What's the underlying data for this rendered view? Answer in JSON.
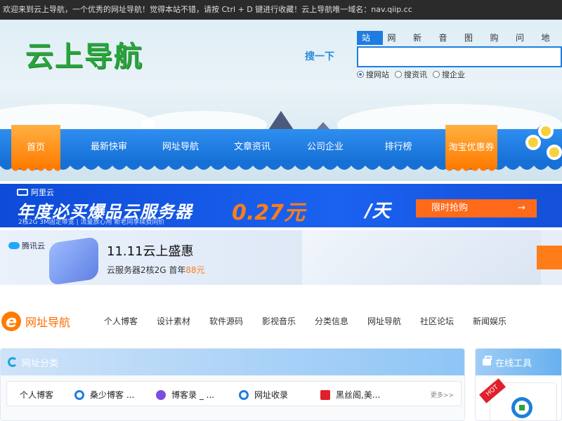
{
  "topbar": {
    "notice": "欢迎来到云上导航，一个优秀的网址导航！觉得本站不错，请按 Ctrl + D 键进行收藏！云上导航唯一域名：nav.qiip.cc"
  },
  "header": {
    "logo": "云上导航",
    "search_label": "搜一下",
    "search_tabs": [
      "站内",
      "网页",
      "新闻",
      "音乐",
      "图片",
      "购物",
      "问答",
      "地图"
    ],
    "search_value": "",
    "search_options": [
      "搜网站",
      "搜资讯",
      "搜企业"
    ],
    "selected_option": "搜网站"
  },
  "nav": {
    "items": [
      "首页",
      "最新快审",
      "网址导航",
      "文章资讯",
      "公司企业",
      "排行榜",
      "淘宝优惠券"
    ]
  },
  "banner_aliyun": {
    "brand": "阿里云",
    "title": "年度必买爆品云服务器",
    "price": "0.27元",
    "unit": "/天",
    "subtitle": "2核2G 3M固定带宽 | 流量放心用 新老同享续费同价",
    "cta": "限时抢购",
    "cta_arrow": "→"
  },
  "banner_tencent": {
    "brand": "腾讯云",
    "title": "11.11云上盛惠",
    "sub_prefix": "云服务器2核2G 首年",
    "sub_price": "88元"
  },
  "site_nav": {
    "title": "网址导航",
    "logo_letter": "e",
    "categories": [
      "个人博客",
      "设计素材",
      "软件源码",
      "影视音乐",
      "分类信息",
      "网址导航",
      "社区论坛",
      "新闻娱乐"
    ]
  },
  "panel": {
    "title": "网址分类",
    "row_label": "个人博客",
    "sites": [
      {
        "name": "桑少博客 ...",
        "color": "#1f7de0"
      },
      {
        "name": "博客录 _ ...",
        "color": "#7b4ddc"
      },
      {
        "name": "网址收录",
        "color": "#1f7de0"
      },
      {
        "name": "黑丝阁,美...",
        "color": "#e0202a"
      }
    ],
    "more": "更多>>"
  },
  "tools": {
    "title": "在线工具",
    "badge": "HOT"
  }
}
